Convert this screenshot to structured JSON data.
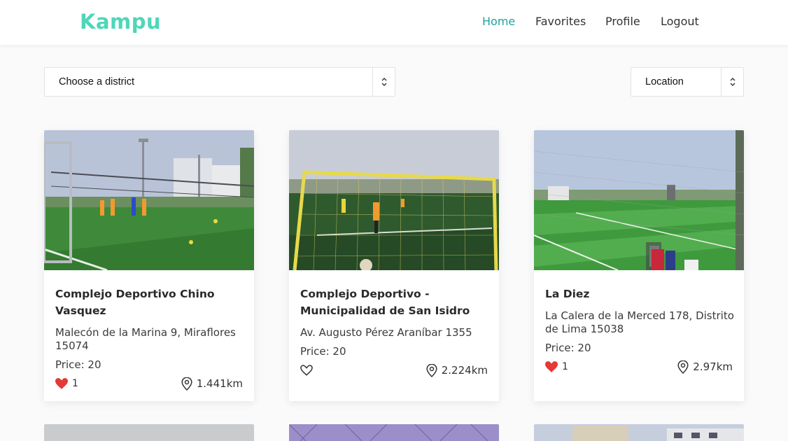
{
  "app": {
    "logo": "Kampu"
  },
  "nav": [
    {
      "label": "Home",
      "active": true
    },
    {
      "label": "Favorites",
      "active": false
    },
    {
      "label": "Profile",
      "active": false
    },
    {
      "label": "Logout",
      "active": false
    }
  ],
  "filters": {
    "district": {
      "selected": "Choose a district"
    },
    "sort": {
      "selected": "Location"
    }
  },
  "colors": {
    "accent": "#1ea3a0",
    "logo": "#4fd6b9",
    "heart": "#e53935"
  },
  "cards": [
    {
      "name": "Complejo Deportivo Chino Vasquez",
      "address": "Malecón de la Marina 9, Miraflores 15074",
      "price": "Price: 20",
      "likes": "1",
      "liked": true,
      "distance": "1.441km"
    },
    {
      "name": "Complejo Deportivo - Municipalidad de San Isidro",
      "address": "Av. Augusto Pérez Araníbar 1355",
      "price": "Price: 20",
      "likes": "",
      "liked": false,
      "distance": "2.224km"
    },
    {
      "name": "La Diez",
      "address": "La Calera de la Merced 178, Distrito de Lima 15038",
      "price": "Price: 20",
      "likes": "1",
      "liked": true,
      "distance": "2.97km"
    }
  ]
}
